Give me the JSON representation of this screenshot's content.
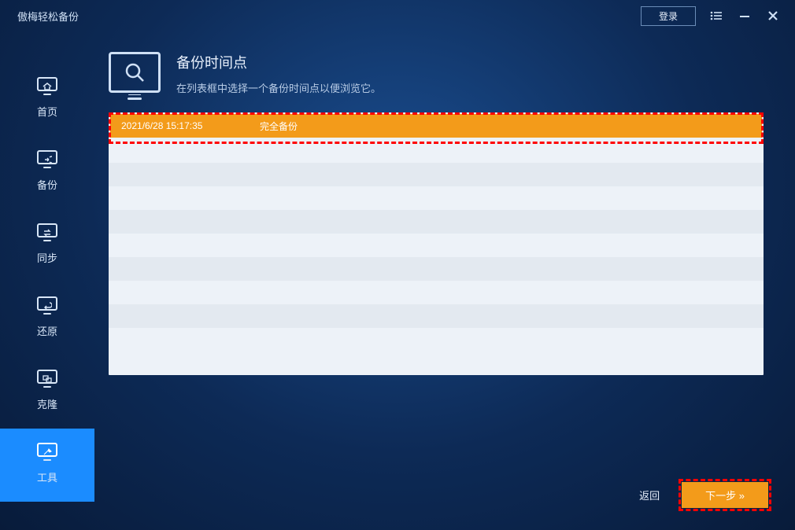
{
  "titlebar": {
    "app_title": "傲梅轻松备份",
    "login_label": "登录"
  },
  "sidebar": {
    "items": [
      {
        "label": "首页"
      },
      {
        "label": "备份"
      },
      {
        "label": "同步"
      },
      {
        "label": "还原"
      },
      {
        "label": "克隆"
      },
      {
        "label": "工具"
      }
    ]
  },
  "main": {
    "title": "备份时间点",
    "subtitle": "在列表框中选择一个备份时间点以便浏览它。",
    "rows": [
      {
        "time": "2021/6/28 15:17:35",
        "type": "完全备份",
        "selected": true
      }
    ]
  },
  "footer": {
    "back_label": "返回",
    "next_label": "下一步 »"
  }
}
